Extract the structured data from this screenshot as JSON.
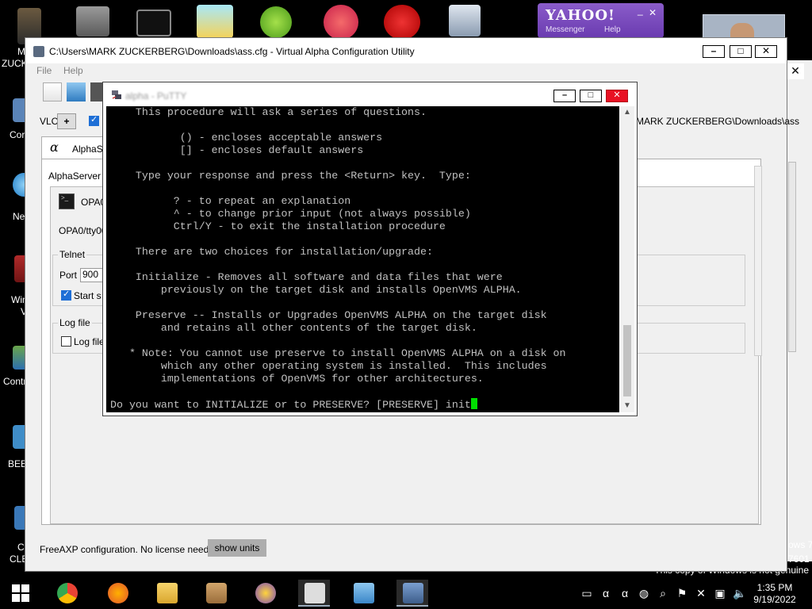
{
  "desktop": {
    "left_labels": [
      "M",
      "ZUCK",
      "Cor",
      "Ne",
      "Win",
      "V",
      "Contr",
      "BEE",
      "C",
      "CLE"
    ],
    "yahoo": {
      "logo": "YAHOO!",
      "messenger": "Messenger",
      "help": "Help",
      "ctrl_minimize": "_",
      "ctrl_close": "✕"
    },
    "top_icons": [
      "mark-folder-icon",
      "scanner-icon",
      "cmd-icon",
      "outlook-icon",
      "angry-birds-icon",
      "picsart-icon",
      "dev-cpp-icon",
      "pc-icon"
    ],
    "watermark": "This copy of Windows is not genuine",
    "winver_lines": [
      "ows 7",
      "7601"
    ]
  },
  "config_window": {
    "title": "C:\\Users\\MARK ZUCKERBERG\\Downloads\\ass.cfg - Virtual Alpha Configuration Utility",
    "menu": [
      "File",
      "Help"
    ],
    "vm_label": "VLC",
    "vm_add": "+",
    "path": "MARK ZUCKERBERG\\Downloads\\ass",
    "tab_label": "AlphaSe",
    "server": "AlphaServer 4",
    "opa_label": "OPA0/",
    "tty_label": "OPA0/tty00",
    "telnet_legend": "Telnet",
    "port_label": "Port",
    "port_value": "900",
    "start_label": "Start s",
    "logfile_legend": "Log file",
    "logfile_label": "Log file",
    "status": "FreeAXP configuration. No license needed.",
    "show_units": "show units"
  },
  "putty": {
    "title": "alpha - PuTTY",
    "terminal_lines": [
      "    This procedure will ask a series of questions.",
      "",
      "           () - encloses acceptable answers",
      "           [] - encloses default answers",
      "",
      "    Type your response and press the <Return> key.  Type:",
      "",
      "          ? - to repeat an explanation",
      "          ^ - to change prior input (not always possible)",
      "          Ctrl/Y - to exit the installation procedure",
      "",
      "    There are two choices for installation/upgrade:",
      "",
      "    Initialize - Removes all software and data files that were",
      "        previously on the target disk and installs OpenVMS ALPHA.",
      "",
      "    Preserve -- Installs or Upgrades OpenVMS ALPHA on the target disk",
      "        and retains all other contents of the target disk.",
      "",
      "   * Note: You cannot use preserve to install OpenVMS ALPHA on a disk on",
      "        which any other operating system is installed.  This includes",
      "        implementations of OpenVMS for other architectures.",
      ""
    ],
    "prompt": "Do you want to INITIALIZE or to PRESERVE? [PRESERVE] init"
  },
  "taskbar": {
    "time": "1:35 PM",
    "date": "9/19/2022"
  },
  "colors": {
    "terminal_bg": "#000000",
    "terminal_fg": "#c0c0c0",
    "cursor": "#00e000",
    "yahoo_purple": "#7a4bbd",
    "close_red": "#e81123"
  }
}
